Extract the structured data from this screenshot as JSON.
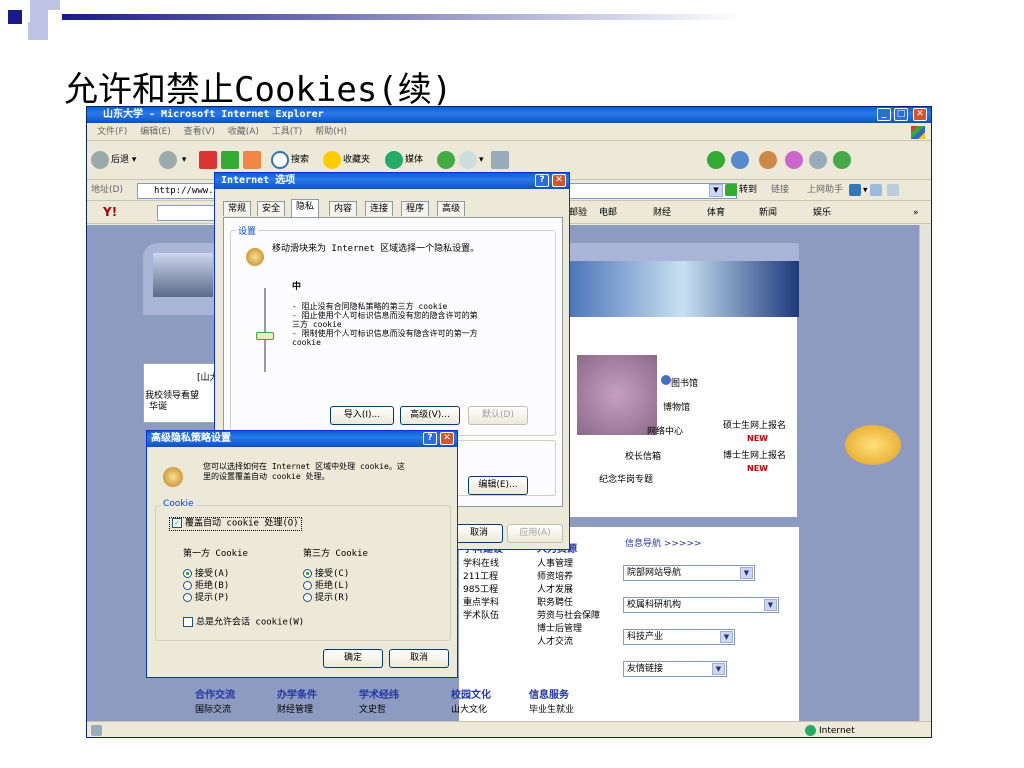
{
  "slide": {
    "title": "允许和禁止Cookies(续)"
  },
  "ie": {
    "title": "山东大学 - Microsoft Internet Explorer",
    "menu": [
      "文件(F)",
      "编辑(E)",
      "查看(V)",
      "收藏(A)",
      "工具(T)",
      "帮助(H)"
    ],
    "toolbar": {
      "back": "后退",
      "search": "搜索",
      "favorites": "收藏夹",
      "media": "媒体"
    },
    "address": {
      "label": "地址(D)",
      "value": "http://www.s",
      "go": "转到",
      "links": "链接",
      "helper": "上网助手"
    },
    "yahoo_bar": [
      "邮验",
      "电邮",
      "财经",
      "体育",
      "新闻",
      "娱乐"
    ],
    "status_zone": "Internet"
  },
  "website": {
    "left_box": {
      "heading": "[山大",
      "item": "我校领导看望",
      "item2": "华诞"
    },
    "links": [
      "图书馆",
      "博物馆",
      "网络中心",
      "校长信箱",
      "纪念华岗专题"
    ],
    "apply": [
      "硕士生网上报名",
      "博士生网上报名"
    ],
    "new_badge": "NEW",
    "columns": [
      {
        "heading": "学科建设",
        "items": [
          "学科在线",
          "211工程",
          "985工程",
          "重点学科",
          "学术队伍"
        ]
      },
      {
        "heading": "人力资源",
        "items": [
          "人事管理",
          "师资培养",
          "人才发展",
          "职务聘任",
          "劳资与社会保障",
          "博士后管理",
          "人才交流"
        ]
      }
    ],
    "info_nav": {
      "heading": "信息导航 >>>>>",
      "selects": [
        "院部网站导航",
        "校属科研机构",
        "科技产业",
        "友情链接"
      ]
    },
    "bottom_cols": [
      {
        "heading": "合作交流",
        "item": "国际交流"
      },
      {
        "heading": "办学条件",
        "item": "财经管理"
      },
      {
        "heading": "学术经纬",
        "item": "文史哲"
      },
      {
        "heading": "校园文化",
        "item": "山大文化"
      },
      {
        "heading": "信息服务",
        "item": "毕业生就业"
      }
    ]
  },
  "internet_options": {
    "title": "Internet 选项",
    "tabs": [
      "常规",
      "安全",
      "隐私",
      "内容",
      "连接",
      "程序",
      "高级"
    ],
    "settings_legend": "设置",
    "settings_desc": "移动滑块来为 Internet 区域选择一个隐私设置。",
    "level": "中",
    "level_lines": [
      "- 阻止没有合同隐私策略的第三方 cookie",
      "- 阻止使用个人可标识信息而没有您的隐含许可的第",
      "三方 cookie",
      "- 限制使用个人可标识信息而没有隐含许可的第一方",
      "cookie"
    ],
    "import_btn": "导入(I)...",
    "advanced_btn": "高级(V)...",
    "default_btn": "默认(D)",
    "edit_btn": "编辑(E)...",
    "cancel_btn": "取消",
    "apply_btn": "应用(A)"
  },
  "advanced_privacy": {
    "title": "高级隐私策略设置",
    "desc1": "您可以选择如何在 Internet 区域中处理 cookie。这",
    "desc2": "里的设置覆盖自动 cookie 处理。",
    "cookie_legend": "Cookie",
    "override_label": "覆盖自动 cookie 处理(O)",
    "first_party": {
      "label": "第一方 Cookie",
      "options": [
        "接受(A)",
        "拒绝(B)",
        "提示(P)"
      ]
    },
    "third_party": {
      "label": "第三方 Cookie",
      "options": [
        "接受(C)",
        "拒绝(L)",
        "提示(R)"
      ]
    },
    "session_label": "总是允许会话 cookie(W)",
    "ok_btn": "确定",
    "cancel_btn": "取消"
  }
}
